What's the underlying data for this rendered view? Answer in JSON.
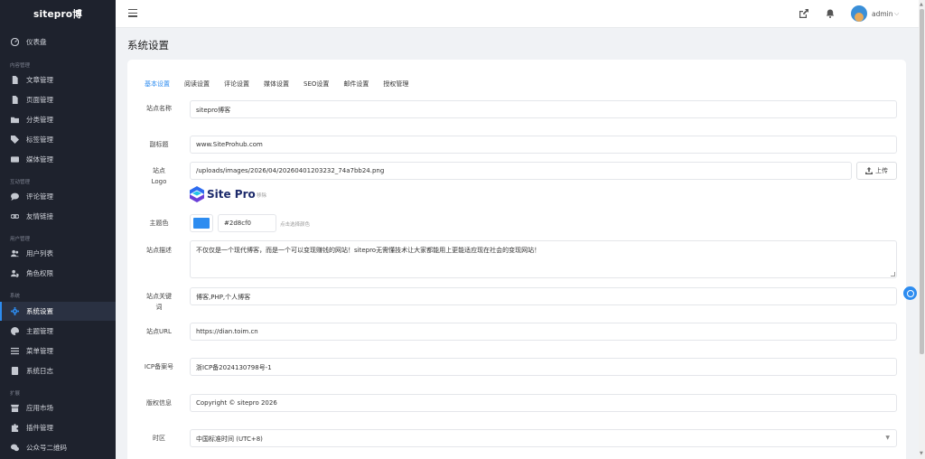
{
  "brand": "sitepro博",
  "sidebar": {
    "items": [
      {
        "label": "仪表盘",
        "icon": "dashboard-icon"
      },
      {
        "label": "文章管理",
        "icon": "file-icon"
      },
      {
        "label": "页面管理",
        "icon": "file-icon"
      },
      {
        "label": "分类管理",
        "icon": "folder-icon"
      },
      {
        "label": "标签管理",
        "icon": "tags-icon"
      },
      {
        "label": "媒体管理",
        "icon": "image-icon"
      },
      {
        "label": "评论管理",
        "icon": "comment-icon"
      },
      {
        "label": "友情链接",
        "icon": "link-icon"
      },
      {
        "label": "用户列表",
        "icon": "users-icon"
      },
      {
        "label": "角色权限",
        "icon": "user-shield-icon"
      },
      {
        "label": "系统设置",
        "icon": "gear-icon",
        "active": true
      },
      {
        "label": "主题管理",
        "icon": "palette-icon"
      },
      {
        "label": "菜单管理",
        "icon": "menu-icon"
      },
      {
        "label": "系统日志",
        "icon": "log-icon"
      },
      {
        "label": "应用市场",
        "icon": "store-icon"
      },
      {
        "label": "插件管理",
        "icon": "puzzle-icon"
      },
      {
        "label": "公众号二维码",
        "icon": "wechat-icon"
      }
    ],
    "groups": [
      "内容管理",
      "互动管理",
      "用户管理",
      "系统",
      "扩展"
    ]
  },
  "topbar": {
    "admin_name": "admin",
    "icons": [
      "menu-icon",
      "external-link-icon",
      "bell-icon",
      "avatar",
      "chevron-down-icon"
    ]
  },
  "page": {
    "title": "系统设置",
    "tabs": [
      "基本设置",
      "阅读设置",
      "评论设置",
      "媒体设置",
      "SEO设置",
      "邮件设置",
      "授权管理"
    ],
    "active_tab": "基本设置"
  },
  "form": {
    "site_name_label": "站点名称",
    "site_name": "sitepro博客",
    "subtitle_label": "副标题",
    "subtitle": "www.SiteProhub.com",
    "logo_label": "站点Logo",
    "logo_path": "/uploads/images/2026/04/20260401203232_74a7bb24.png",
    "upload_label": "上传",
    "logo_text": "Site Pro",
    "remove_label": "移除",
    "color_label": "主题色",
    "color_value": "#2d8cf0",
    "color_hint": "点击选择颜色",
    "desc_label": "站点描述",
    "desc": "不仅仅是一个现代博客，而是一个可以变现赚钱的网站！sitepro无需懂技术让大家都能用上更能适应现在社会的变现网站！",
    "keywords_label": "站点关键词",
    "keywords": "博客,PHP,个人博客",
    "url_label": "站点URL",
    "url": "https://dian.toim.cn",
    "icp_label": "ICP备案号",
    "icp": "浙ICP备2024130798号-1",
    "copyright_label": "版权信息",
    "copyright": "Copyright © sitepro 2026",
    "timezone_label": "时区",
    "timezone": "中国标准时间 (UTC+8)"
  },
  "colors": {
    "accent": "#2d8cf0",
    "sidebar_bg": "#1e222d"
  }
}
